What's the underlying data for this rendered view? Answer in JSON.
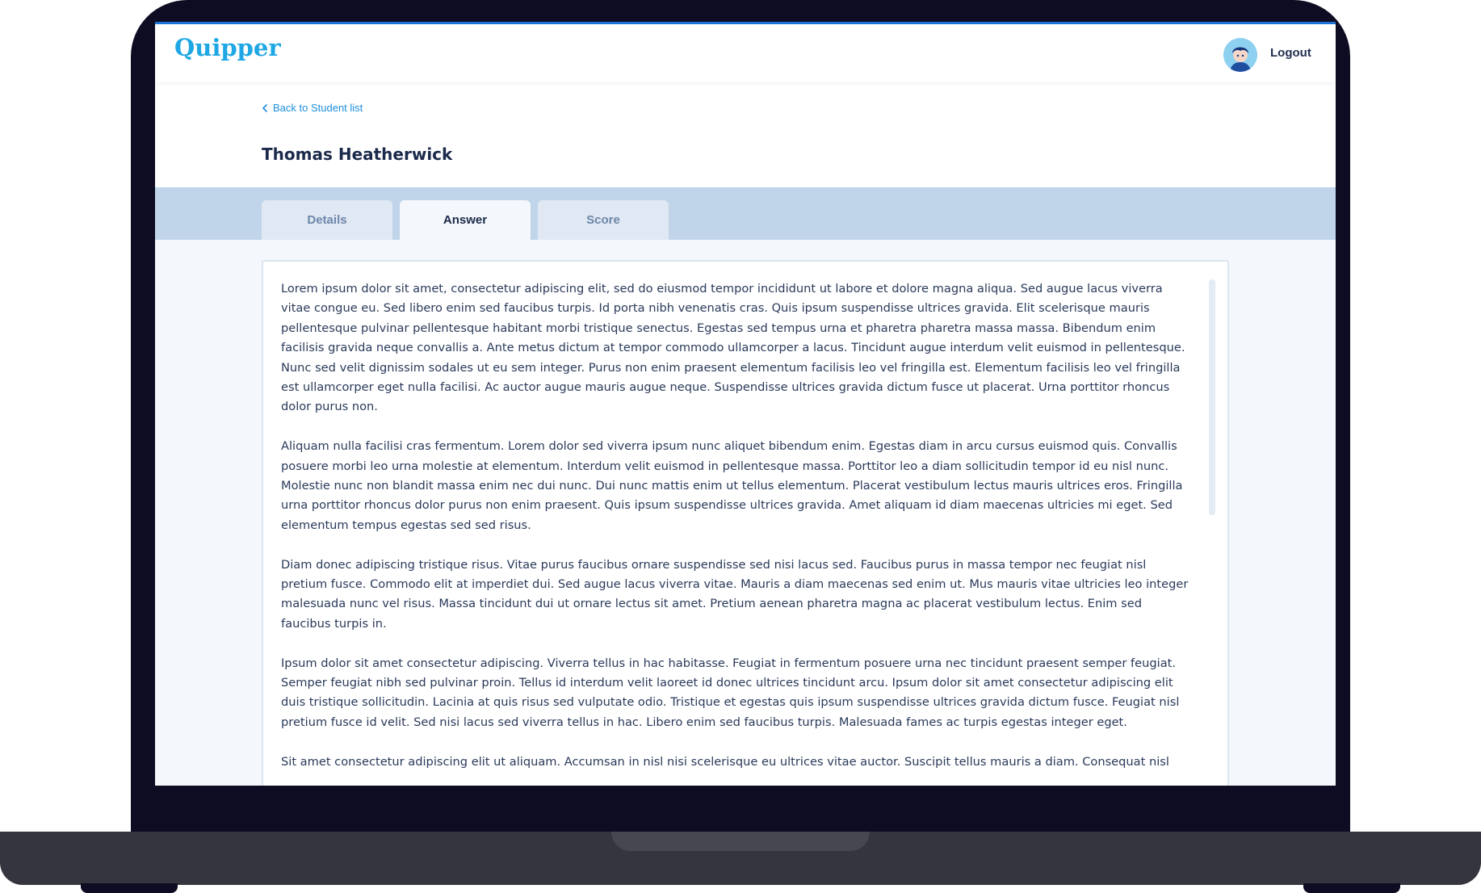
{
  "app": {
    "logo_text": "Quipper",
    "accent_color": "#1ea7e4",
    "logout_label": "Logout",
    "avatar_icon": "student-avatar-icon"
  },
  "page": {
    "back_link_label": "Back to Student list",
    "back_icon": "chevron-left-icon",
    "student_name": "Thomas Heatherwick"
  },
  "tabs": [
    {
      "label": "Details",
      "active": false
    },
    {
      "label": "Answer",
      "active": true
    },
    {
      "label": "Score",
      "active": false
    }
  ],
  "answer": {
    "paragraphs": [
      "Lorem ipsum dolor sit amet, consectetur adipiscing elit, sed do eiusmod tempor incididunt ut labore et dolore magna aliqua. Sed augue lacus viverra vitae congue eu. Sed libero enim sed faucibus turpis. Id porta nibh venenatis cras. Quis ipsum suspendisse ultrices gravida. Elit scelerisque mauris pellentesque pulvinar pellentesque habitant morbi tristique senectus. Egestas sed tempus urna et pharetra pharetra massa massa. Bibendum enim facilisis gravida neque convallis a. Ante metus dictum at tempor commodo ullamcorper a lacus. Tincidunt augue interdum velit euismod in pellentesque. Nunc sed velit dignissim sodales ut eu sem integer. Purus non enim praesent elementum facilisis leo vel fringilla est. Elementum facilisis leo vel fringilla est ullamcorper eget nulla facilisi. Ac auctor augue mauris augue neque. Suspendisse ultrices gravida dictum fusce ut placerat. Urna porttitor rhoncus dolor purus non.",
      "Aliquam nulla facilisi cras fermentum. Lorem dolor sed viverra ipsum nunc aliquet bibendum enim. Egestas diam in arcu cursus euismod quis. Convallis posuere morbi leo urna molestie at elementum. Interdum velit euismod in pellentesque massa. Porttitor leo a diam sollicitudin tempor id eu nisl nunc. Molestie nunc non blandit massa enim nec dui nunc. Dui nunc mattis enim ut tellus elementum. Placerat vestibulum lectus mauris ultrices eros. Fringilla urna porttitor rhoncus dolor purus non enim praesent. Quis ipsum suspendisse ultrices gravida. Amet aliquam id diam maecenas ultricies mi eget. Sed elementum tempus egestas sed sed risus.",
      "Diam donec adipiscing tristique risus. Vitae purus faucibus ornare suspendisse sed nisi lacus sed. Faucibus purus in massa tempor nec feugiat nisl pretium fusce. Commodo elit at imperdiet dui. Sed augue lacus viverra vitae. Mauris a diam maecenas sed enim ut. Mus mauris vitae ultricies leo integer malesuada nunc vel risus. Massa tincidunt dui ut ornare lectus sit amet. Pretium aenean pharetra magna ac placerat vestibulum lectus. Enim sed faucibus turpis in.",
      "Ipsum dolor sit amet consectetur adipiscing. Viverra tellus in hac habitasse. Feugiat in fermentum posuere urna nec tincidunt praesent semper feugiat. Semper feugiat nibh sed pulvinar proin. Tellus id interdum velit laoreet id donec ultrices tincidunt arcu. Ipsum dolor sit amet consectetur adipiscing elit duis tristique sollicitudin. Lacinia at quis risus sed vulputate odio. Tristique et egestas quis ipsum suspendisse ultrices gravida dictum fusce. Feugiat nisl pretium fusce id velit. Sed nisi lacus sed viverra tellus in hac. Libero enim sed faucibus turpis. Malesuada fames ac turpis egestas integer eget.",
      "Sit amet consectetur adipiscing elit ut aliquam. Accumsan in nisl nisi scelerisque eu ultrices vitae auctor. Suscipit tellus mauris a diam. Consequat nisl"
    ]
  }
}
